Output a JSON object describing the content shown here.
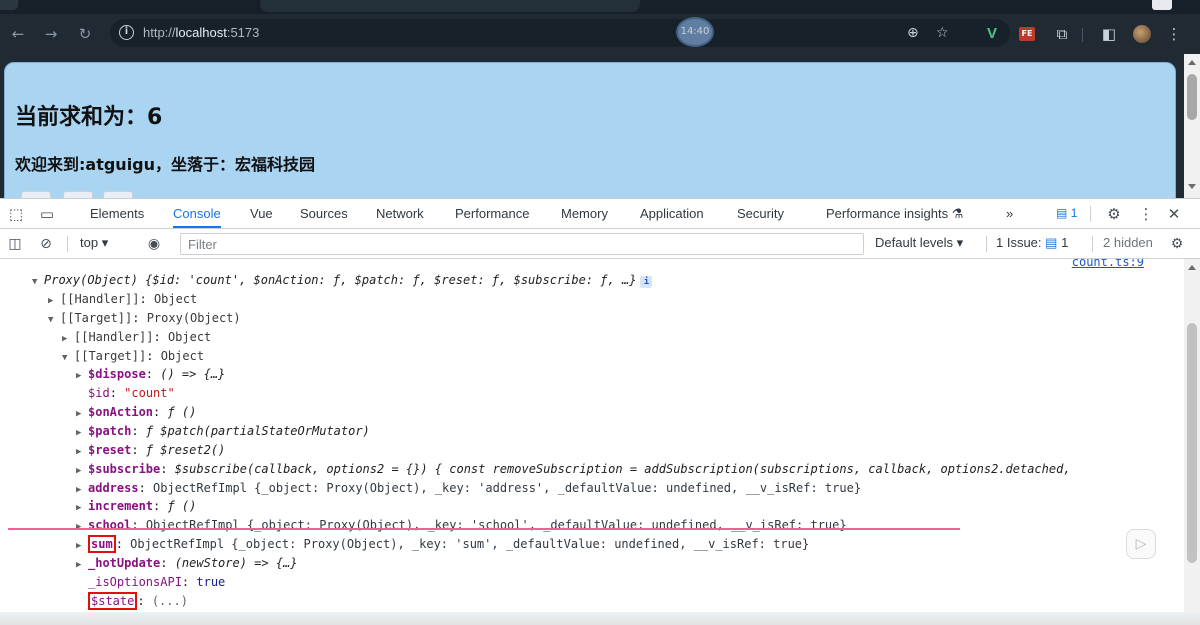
{
  "browser": {
    "url_prefix": "http://",
    "url_host": "localhost",
    "url_port": ":5173",
    "timer": "14:40",
    "icons": {
      "back": "arrow-left-icon",
      "forward": "arrow-right-icon",
      "reload": "reload-icon",
      "zoom": "zoom-icon",
      "bookmark": "star-icon"
    }
  },
  "page": {
    "heading": "当前求和为：6",
    "subheading": "欢迎来到:atguigu，坐落于：宏福科技园"
  },
  "devtools": {
    "tabs": [
      "Elements",
      "Console",
      "Vue",
      "Sources",
      "Network",
      "Performance",
      "Memory",
      "Application",
      "Security",
      "Performance insights"
    ],
    "active_tab": "Console",
    "performance_insights_flask": "⚗",
    "more_tabs": "»",
    "message_count": "1",
    "filterbar": {
      "context": "top",
      "filter_placeholder": "Filter",
      "levels": "Default levels",
      "issue_label": "1 Issue:",
      "issue_count": "1",
      "hidden": "2 hidden"
    },
    "console": {
      "source_link": "count.ts:9",
      "root_summary": "Proxy(Object) {$id: 'count', $onAction: ƒ, $patch: ƒ, $reset: ƒ, $subscribe: ƒ, …}",
      "lines": [
        {
          "indent": 0,
          "tri": "▶",
          "key": "[[Handler]]",
          "sep": ": ",
          "value": "Object",
          "kind": "internal"
        },
        {
          "indent": 0,
          "tri": "▼",
          "key": "[[Target]]",
          "sep": ": ",
          "value": "Proxy(Object)",
          "kind": "internal"
        },
        {
          "indent": 1,
          "tri": "▶",
          "key": "[[Handler]]",
          "sep": ": ",
          "value": "Object",
          "kind": "internal"
        },
        {
          "indent": 1,
          "tri": "▼",
          "key": "[[Target]]",
          "sep": ": ",
          "value": "Object",
          "kind": "internal"
        },
        {
          "indent": 2,
          "tri": "▶",
          "key": "$dispose",
          "sep": ": ",
          "value": "() => {…}",
          "kind": "fn"
        },
        {
          "indent": 2,
          "tri": "",
          "key": "$id",
          "sep": ": ",
          "value": "\"count\"",
          "kind": "str"
        },
        {
          "indent": 2,
          "tri": "▶",
          "key": "$onAction",
          "sep": ": ",
          "value": "ƒ ()",
          "kind": "fn"
        },
        {
          "indent": 2,
          "tri": "▶",
          "key": "$patch",
          "sep": ": ",
          "value": "ƒ $patch(partialStateOrMutator)",
          "kind": "fn"
        },
        {
          "indent": 2,
          "tri": "▶",
          "key": "$reset",
          "sep": ": ",
          "value": "ƒ $reset2()",
          "kind": "fn"
        },
        {
          "indent": 2,
          "tri": "▶",
          "key": "$subscribe",
          "sep": ": ",
          "value": "$subscribe(callback, options2 = {}) { const removeSubscription = addSubscription(subscriptions, callback, options2.detached,",
          "kind": "fn"
        },
        {
          "indent": 2,
          "tri": "▶",
          "key": "address",
          "sep": ": ",
          "value": "ObjectRefImpl {_object: Proxy(Object), _key: 'address', _defaultValue: undefined, __v_isRef: true}",
          "kind": "obj"
        },
        {
          "indent": 2,
          "tri": "▶",
          "key": "increment",
          "sep": ": ",
          "value": "ƒ ()",
          "kind": "fn"
        },
        {
          "indent": 2,
          "tri": "▶",
          "key": "school",
          "sep": ": ",
          "value": "ObjectRefImpl {_object: Proxy(Object), _key: 'school', _defaultValue: undefined, __v_isRef: true}",
          "kind": "obj"
        },
        {
          "indent": 2,
          "tri": "▶",
          "key": "sum",
          "sep": ": ",
          "value": "ObjectRefImpl {_object: Proxy(Object), _key: 'sum', _defaultValue: undefined, __v_isRef: true}",
          "kind": "obj",
          "highlight": true
        },
        {
          "indent": 2,
          "tri": "▶",
          "key": "_hotUpdate",
          "sep": ": ",
          "value": "(newStore) => {…}",
          "kind": "fn"
        },
        {
          "indent": 2,
          "tri": "",
          "key": "_isOptionsAPI",
          "sep": ": ",
          "value": "true",
          "kind": "bool"
        },
        {
          "indent": 2,
          "tri": "",
          "key": "$state",
          "sep": ": ",
          "value": "(...)",
          "kind": "getter",
          "highlight": true
        }
      ]
    }
  },
  "colors": {
    "page_background": "#a9d4f2",
    "devtools_accent": "#1a73e8",
    "highlight_box": "#e01010",
    "annotation_rule": "#f06292"
  }
}
